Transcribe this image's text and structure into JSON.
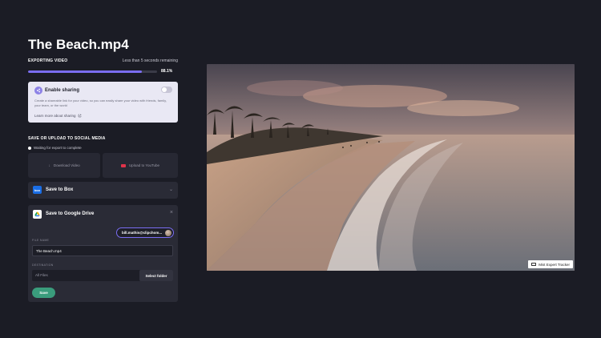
{
  "file": {
    "title": "The Beach.mp4"
  },
  "export": {
    "label": "EXPORTING VIDEO",
    "remaining": "Less than 5 seconds remaining",
    "progress": 0.881,
    "progress_text": "88.1%"
  },
  "sharing": {
    "title": "Enable sharing",
    "enabled": false,
    "description": "Create a shareable link for your video, so you can easily share your video with friends, family, your team, or the world",
    "learn_more": "Learn more about sharing"
  },
  "social": {
    "section_title": "SAVE OR UPLOAD TO SOCIAL MEDIA",
    "waiting_text": "Waiting for export to complete",
    "download_label": "Download Video",
    "youtube_label": "Upload to YouTube"
  },
  "box": {
    "logo_text": "box",
    "label": "Save to Box"
  },
  "gdrive": {
    "title": "Save to Google Drive",
    "account": "bill.mathis@clipchom...",
    "filename_label": "FILE NAME",
    "filename_value": "The Beach.mp4",
    "destination_label": "DESTINATION",
    "destination_value": "All Files",
    "select_folder_label": "Select folder",
    "save_label": "Save"
  },
  "video": {
    "badge_label": "Mist Expert Tracker"
  },
  "colors": {
    "accent": "#7a6df2",
    "save": "#3a9c7c",
    "background": "#1b1c25",
    "panel": "#2a2b36"
  },
  "icons": [
    "share-icon",
    "toggle",
    "external-link-icon",
    "download-icon",
    "youtube-icon",
    "box-logo",
    "chevron-down-icon",
    "google-drive-icon",
    "close-icon",
    "tracker-icon"
  ]
}
